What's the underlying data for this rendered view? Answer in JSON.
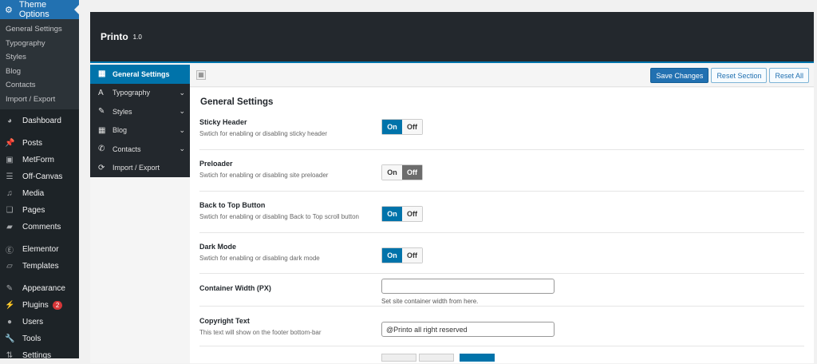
{
  "wp_menu": {
    "active": "Theme Options",
    "sub": [
      "General Settings",
      "Typography",
      "Styles",
      "Blog",
      "Contacts",
      "Import / Export"
    ],
    "items": [
      {
        "label": "Dashboard",
        "icon": "dashboard-icon"
      },
      {
        "label": "Posts",
        "icon": "pin-icon"
      },
      {
        "label": "MetForm",
        "icon": "form-icon"
      },
      {
        "label": "Off-Canvas",
        "icon": "list-icon"
      },
      {
        "label": "Media",
        "icon": "media-icon"
      },
      {
        "label": "Pages",
        "icon": "pages-icon"
      },
      {
        "label": "Comments",
        "icon": "comment-icon"
      },
      {
        "label": "Elementor",
        "icon": "elementor-icon"
      },
      {
        "label": "Templates",
        "icon": "folder-icon"
      },
      {
        "label": "Appearance",
        "icon": "brush-icon"
      },
      {
        "label": "Plugins",
        "icon": "plugin-icon",
        "badge": "2"
      },
      {
        "label": "Users",
        "icon": "user-icon"
      },
      {
        "label": "Tools",
        "icon": "wrench-icon"
      },
      {
        "label": "Settings",
        "icon": "settings-icon"
      }
    ]
  },
  "header": {
    "title": "Printo",
    "version": "1.0"
  },
  "nav": [
    "General Settings",
    "Typography",
    "Styles",
    "Blog",
    "Contacts",
    "Import / Export"
  ],
  "toolbar": {
    "save": "Save Changes",
    "reset_section": "Reset Section",
    "reset_all": "Reset All"
  },
  "section_title": "General Settings",
  "settings": [
    {
      "label": "Sticky Header",
      "desc": "Swtich for enabling or disabling sticky header",
      "on": "On",
      "off": "Off",
      "value": "on"
    },
    {
      "label": "Preloader",
      "desc": "Swtich for enabling or disabling site preloader",
      "on": "On",
      "off": "Off",
      "value": "off"
    },
    {
      "label": "Back to Top Button",
      "desc": "Swtich for enabling or disabling Back to Top scroll button",
      "on": "On",
      "off": "Off",
      "value": "on"
    },
    {
      "label": "Dark Mode",
      "desc": "Swtich for enabling or disabling dark mode",
      "on": "On",
      "off": "Off",
      "value": "on"
    }
  ],
  "container_width": {
    "label": "Container Width (PX)",
    "value": "",
    "help": "Set site container width from here."
  },
  "copyright": {
    "label": "Copyright Text",
    "desc": "This text will show on the footer bottom-bar",
    "value": "@Printo all right reserved"
  }
}
